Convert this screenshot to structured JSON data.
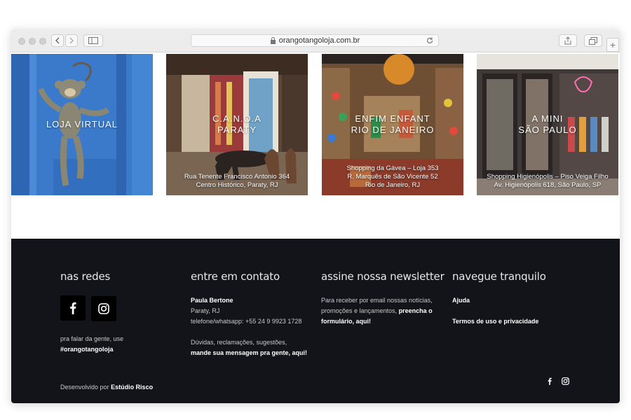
{
  "browser": {
    "url": "orangotangoloja.com.br"
  },
  "tiles": [
    {
      "title": "LOJA VIRTUAL",
      "address": ""
    },
    {
      "title": "C.A.N.O.A\nPARATY",
      "address": "Rua Tenente Francisco Antonio 364\nCentro Histórico, Paraty, RJ"
    },
    {
      "title": "ENFIM ENFANT\nRIO DE JANEIRO",
      "address": "Shopping da Gávea – Loja 353\nR. Marquês de São Vicente 52\nRio de Janeiro, RJ"
    },
    {
      "title": "A MINI\nSÃO PAULO",
      "address": "Shopping Higienópolis – Piso Veiga Filho\nAv. Higienópolis 618, São Paulo, SP"
    }
  ],
  "footer": {
    "social": {
      "heading": "nas redes",
      "text": "pra falar da gente, use",
      "hashtag": "#orangotangoloja"
    },
    "contact": {
      "heading": "entre em contato",
      "name": "Paula Bertone",
      "city": "Paraty, RJ",
      "phone": "telefone/whatsapp: +55 24 9 9923 1728",
      "doubts": "Dúvidas, reclamações, sugestões,",
      "link": "mande sua mensagem pra gente, aqui!"
    },
    "newsletter": {
      "heading": "assine nossa newsletter",
      "text": "Para receber por email nossas notícias, promoções e lançamentos,",
      "link": "preencha o formulário, aqui!"
    },
    "nav": {
      "heading": "navegue tranquilo",
      "help": "Ajuda",
      "terms": "Termos de uso e privacidade"
    },
    "dev_prefix": "Desenvolvido por",
    "dev_name": "Estúdio Risco"
  },
  "colors": {
    "footer_bg": "#13141a",
    "tile_blue": "#3a78c8"
  }
}
